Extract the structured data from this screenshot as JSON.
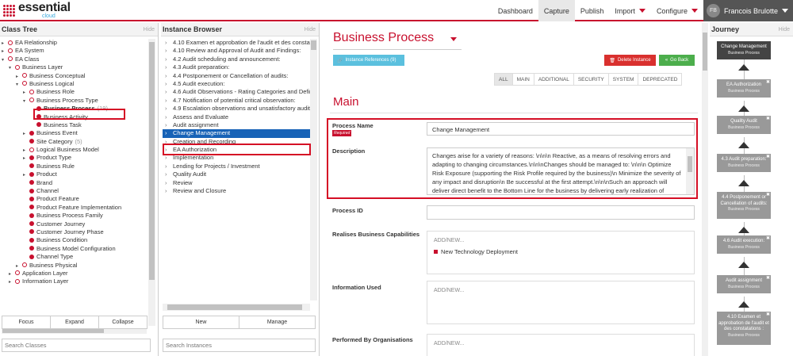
{
  "app": {
    "logo_word": "essential",
    "logo_sub": "cloud"
  },
  "nav": {
    "items": [
      {
        "label": "Dashboard",
        "active": false,
        "dropdown": false
      },
      {
        "label": "Capture",
        "active": true,
        "dropdown": false
      },
      {
        "label": "Publish",
        "active": false,
        "dropdown": false
      },
      {
        "label": "Import",
        "active": false,
        "dropdown": true
      },
      {
        "label": "Configure",
        "active": false,
        "dropdown": true
      }
    ],
    "user": {
      "initials": "FB",
      "name": "Francois Brulotte"
    }
  },
  "class_tree": {
    "title": "Class Tree",
    "hide": "Hide",
    "items": [
      {
        "label": "EA Relationship",
        "level": 0,
        "arrow": "▸",
        "icon": "open"
      },
      {
        "label": "EA System",
        "level": 0,
        "arrow": "▸",
        "icon": "open"
      },
      {
        "label": "EA Class",
        "level": 0,
        "arrow": "▾",
        "icon": "open"
      },
      {
        "label": "Business Layer",
        "level": 1,
        "arrow": "▾",
        "icon": "open"
      },
      {
        "label": "Business Conceptual",
        "level": 2,
        "arrow": "▸",
        "icon": "open"
      },
      {
        "label": "Business Logical",
        "level": 2,
        "arrow": "▾",
        "icon": "open"
      },
      {
        "label": "Business Role",
        "level": 3,
        "arrow": "▸",
        "icon": "open"
      },
      {
        "label": "Business Process Type",
        "level": 3,
        "arrow": "▾",
        "icon": "open"
      },
      {
        "label": "Business Process",
        "level": 4,
        "arrow": "",
        "icon": "filled",
        "count": "(19)",
        "bold": true
      },
      {
        "label": "Business Activity",
        "level": 4,
        "arrow": "",
        "icon": "filled"
      },
      {
        "label": "Business Task",
        "level": 4,
        "arrow": "",
        "icon": "filled"
      },
      {
        "label": "Business Event",
        "level": 3,
        "arrow": "▸",
        "icon": "filled"
      },
      {
        "label": "Site Category",
        "level": 3,
        "arrow": "",
        "icon": "filled",
        "count": "(5)"
      },
      {
        "label": "Logical Business Model",
        "level": 3,
        "arrow": "▸",
        "icon": "open"
      },
      {
        "label": "Product Type",
        "level": 3,
        "arrow": "▸",
        "icon": "filled"
      },
      {
        "label": "Business Rule",
        "level": 3,
        "arrow": "",
        "icon": "filled"
      },
      {
        "label": "Product",
        "level": 3,
        "arrow": "▸",
        "icon": "filled"
      },
      {
        "label": "Brand",
        "level": 3,
        "arrow": "",
        "icon": "filled"
      },
      {
        "label": "Channel",
        "level": 3,
        "arrow": "",
        "icon": "filled"
      },
      {
        "label": "Product Feature",
        "level": 3,
        "arrow": "",
        "icon": "filled"
      },
      {
        "label": "Product Feature Implementation",
        "level": 3,
        "arrow": "",
        "icon": "filled"
      },
      {
        "label": "Business Process Family",
        "level": 3,
        "arrow": "",
        "icon": "filled"
      },
      {
        "label": "Customer Journey",
        "level": 3,
        "arrow": "",
        "icon": "filled"
      },
      {
        "label": "Customer Journey Phase",
        "level": 3,
        "arrow": "",
        "icon": "filled"
      },
      {
        "label": "Business Condition",
        "level": 3,
        "arrow": "",
        "icon": "filled"
      },
      {
        "label": "Business Model Configuration",
        "level": 3,
        "arrow": "",
        "icon": "filled"
      },
      {
        "label": "Channel Type",
        "level": 3,
        "arrow": "",
        "icon": "filled"
      },
      {
        "label": "Business Physical",
        "level": 2,
        "arrow": "▸",
        "icon": "open"
      },
      {
        "label": "Application Layer",
        "level": 1,
        "arrow": "▸",
        "icon": "open"
      },
      {
        "label": "Information Layer",
        "level": 1,
        "arrow": "▸",
        "icon": "open"
      }
    ],
    "buttons": [
      "Focus",
      "Expand",
      "Collapse"
    ],
    "search_placeholder": "Search Classes"
  },
  "instance_browser": {
    "title": "Instance Browser",
    "hide": "Hide",
    "items": [
      "4.10 Examen et approbation de l'audit et des constatat",
      "4.10 Review and Approval of Audit and Findings:",
      "4.2 Audit scheduling and announcement:",
      "4.3 Audit preparation:",
      "4.4 Postponement or Cancellation of audits:",
      "4.5 Audit execution:",
      "4.6 Audit Observations - Rating Categories and Definiti",
      "4.7 Notification of potential critical observation:",
      "4.9 Escalation observations and unsatisfactory audit o",
      "Assess and Evaluate",
      "Audit assignment",
      "Change Management",
      "Creation and Recording",
      "EA Authorization",
      "Implementation",
      "Lending for Projects / Investment",
      "Quality Audit",
      "Review",
      "Review and Closure"
    ],
    "selected_index": 11,
    "buttons": [
      "New",
      "Manage"
    ],
    "search_placeholder": "Search Instances"
  },
  "main": {
    "title": "Business Process",
    "refs_button": "Instance References (9)",
    "delete_button": "Delete Instance",
    "back_button": "Go Back",
    "tabs": [
      {
        "label": "ALL",
        "active": true
      },
      {
        "label": "MAIN",
        "active": false
      },
      {
        "label": "ADDITIONAL",
        "active": false
      },
      {
        "label": "SECURITY",
        "active": false
      },
      {
        "label": "SYSTEM",
        "active": false
      },
      {
        "label": "DEPRECATED",
        "active": false
      }
    ],
    "section": "Main",
    "process_name": {
      "label": "Process Name",
      "required": "Required",
      "value": "Change Management"
    },
    "description": {
      "label": "Description",
      "value": "Changes arise for a variety of reasons: \\n\\n\\n    Reactive, as a means of resolving errors and adapting to changing circumstances.\\n\\n\\nChanges should be managed to: \\n\\n\\n    Optimize Risk Exposure (supporting the Risk Profile required by the business)\\n    Minimize the severity of any impact and disruption\\n    Be successful at the first attempt.\\n\\n\\nSuch an approach will deliver direct benefit to the Bottom Line for the business by delivering early realization of"
    },
    "process_id": {
      "label": "Process ID",
      "value": ""
    },
    "realises": {
      "label": "Realises Business Capabilities",
      "add": "ADD/NEW...",
      "items": [
        "New Technology Deployment"
      ]
    },
    "info_used": {
      "label": "Information Used",
      "add": "ADD/NEW..."
    },
    "performed_by": {
      "label": "Performed By Organisations",
      "add": "ADD/NEW..."
    }
  },
  "journey": {
    "title": "Journey",
    "hide": "Hide",
    "cards": [
      {
        "name": "Change Management",
        "type": "Business Process",
        "current": true
      },
      {
        "name": "EA Authorization",
        "type": "Business Process",
        "current": false
      },
      {
        "name": "Quality Audit",
        "type": "Business Process",
        "current": false
      },
      {
        "name": "4.3 Audit preparation:",
        "type": "Business Process",
        "current": false
      },
      {
        "name": "4.4 Postponement or Cancellation of audits:",
        "type": "Business Process",
        "current": false
      },
      {
        "name": "4.6 Audit execution:",
        "type": "Business Process",
        "current": false
      },
      {
        "name": "Audit assignment",
        "type": "Business Process",
        "current": false
      },
      {
        "name": "4.10 Examen et approbation de l'audit et des constatations :",
        "type": "Business Process",
        "current": false
      }
    ]
  },
  "colors": {
    "accent": "#c8102e",
    "selected": "#1863b7",
    "refs": "#5bc0de",
    "delete": "#d9302e",
    "back": "#4cae4c",
    "highlight": "#d50f25"
  }
}
